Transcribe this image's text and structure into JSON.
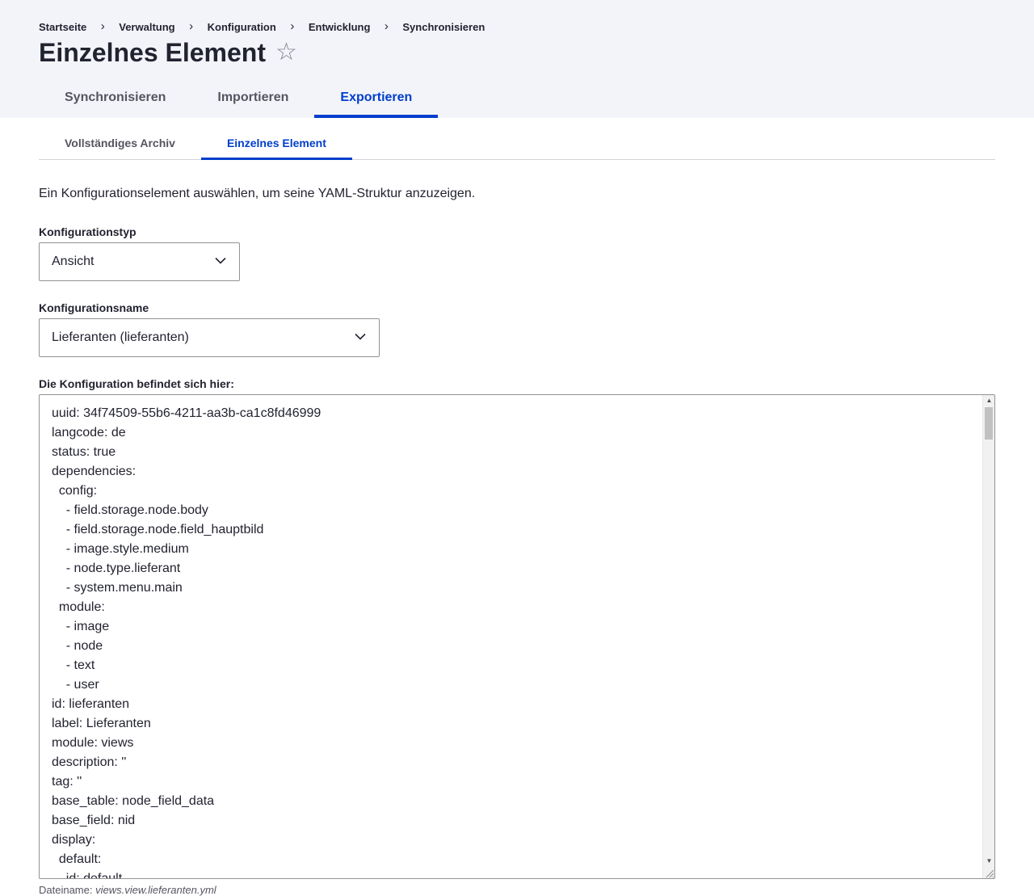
{
  "breadcrumb": [
    "Startseite",
    "Verwaltung",
    "Konfiguration",
    "Entwicklung",
    "Synchronisieren"
  ],
  "breadcrumb_separator": "›",
  "page": {
    "title": "Einzelnes Element",
    "star_icon": "☆"
  },
  "primary_tabs": [
    {
      "label": "Synchronisieren",
      "active": false
    },
    {
      "label": "Importieren",
      "active": false
    },
    {
      "label": "Exportieren",
      "active": true
    }
  ],
  "secondary_tabs": [
    {
      "label": "Vollständiges Archiv",
      "active": false
    },
    {
      "label": "Einzelnes Element",
      "active": true
    }
  ],
  "intro": "Ein Konfigurationselement auswählen, um seine YAML-Struktur anzuzeigen.",
  "config_type": {
    "label": "Konfigurationstyp",
    "value": "Ansicht"
  },
  "config_name": {
    "label": "Konfigurationsname",
    "value": "Lieferanten (lieferanten)"
  },
  "export": {
    "label": "Die Konfiguration befindet sich hier:",
    "lines": [
      "uuid: 34f74509-55b6-4211-aa3b-ca1c8fd46999",
      "langcode: de",
      "status: true",
      "dependencies:",
      "  config:",
      "    - field.storage.node.body",
      "    - field.storage.node.field_hauptbild",
      "    - image.style.medium",
      "    - node.type.lieferant",
      "    - system.menu.main",
      "  module:",
      "    - image",
      "    - node",
      "    - text",
      "    - user",
      "id: lieferanten",
      "label: Lieferanten",
      "module: views",
      "description: ''",
      "tag: ''",
      "base_table: node_field_data",
      "base_field: nid",
      "display:",
      "  default:",
      "    id: default"
    ]
  },
  "filename": {
    "prefix": "Dateiname:",
    "value": "views.view.lieferanten.yml"
  },
  "colors": {
    "accent": "#003ecc",
    "header_bg": "#f3f4f9",
    "text": "#222330"
  }
}
